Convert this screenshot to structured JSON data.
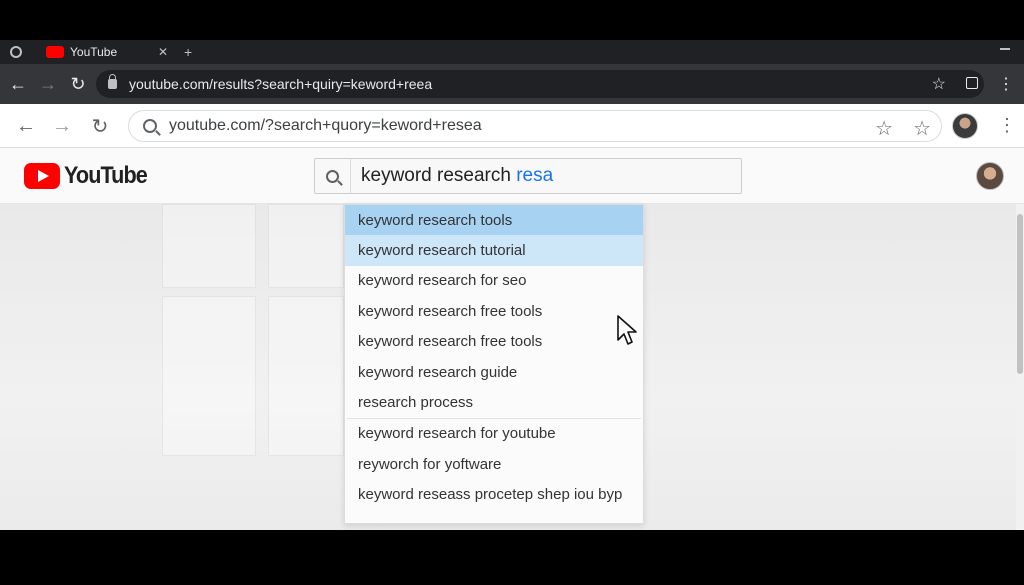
{
  "outer_browser": {
    "tab_title": "YouTube",
    "url": "youtube.com/results?search+quiry=keword+reea"
  },
  "inner_browser": {
    "url": "youtube.com/?search+quory=keword+resea"
  },
  "youtube": {
    "logo_text": "YouTube",
    "search_query_base": "keyword research ",
    "search_query_typed": "resa"
  },
  "suggestions": [
    "keyword research tools",
    "keyword research tutorial",
    "keyword research for seo",
    "keyword research free tools",
    "keyword research free tools",
    "keyword research guide",
    "research process",
    "keyword research for youtube",
    "reyworch for yoftware",
    "keyword reseass procetep shep iou byp"
  ],
  "colors": {
    "youtube_red": "#ff0000",
    "highlight_primary": "#a7d2f2",
    "highlight_secondary": "#cde6f8",
    "typed_text": "#1a73e8"
  },
  "icons": {
    "back": "arrow-left-icon",
    "forward": "arrow-right-icon",
    "reload": "reload-icon",
    "lock": "lock-icon",
    "search": "search-icon",
    "bookmark": "star-icon",
    "menu": "kebab-menu-icon"
  }
}
